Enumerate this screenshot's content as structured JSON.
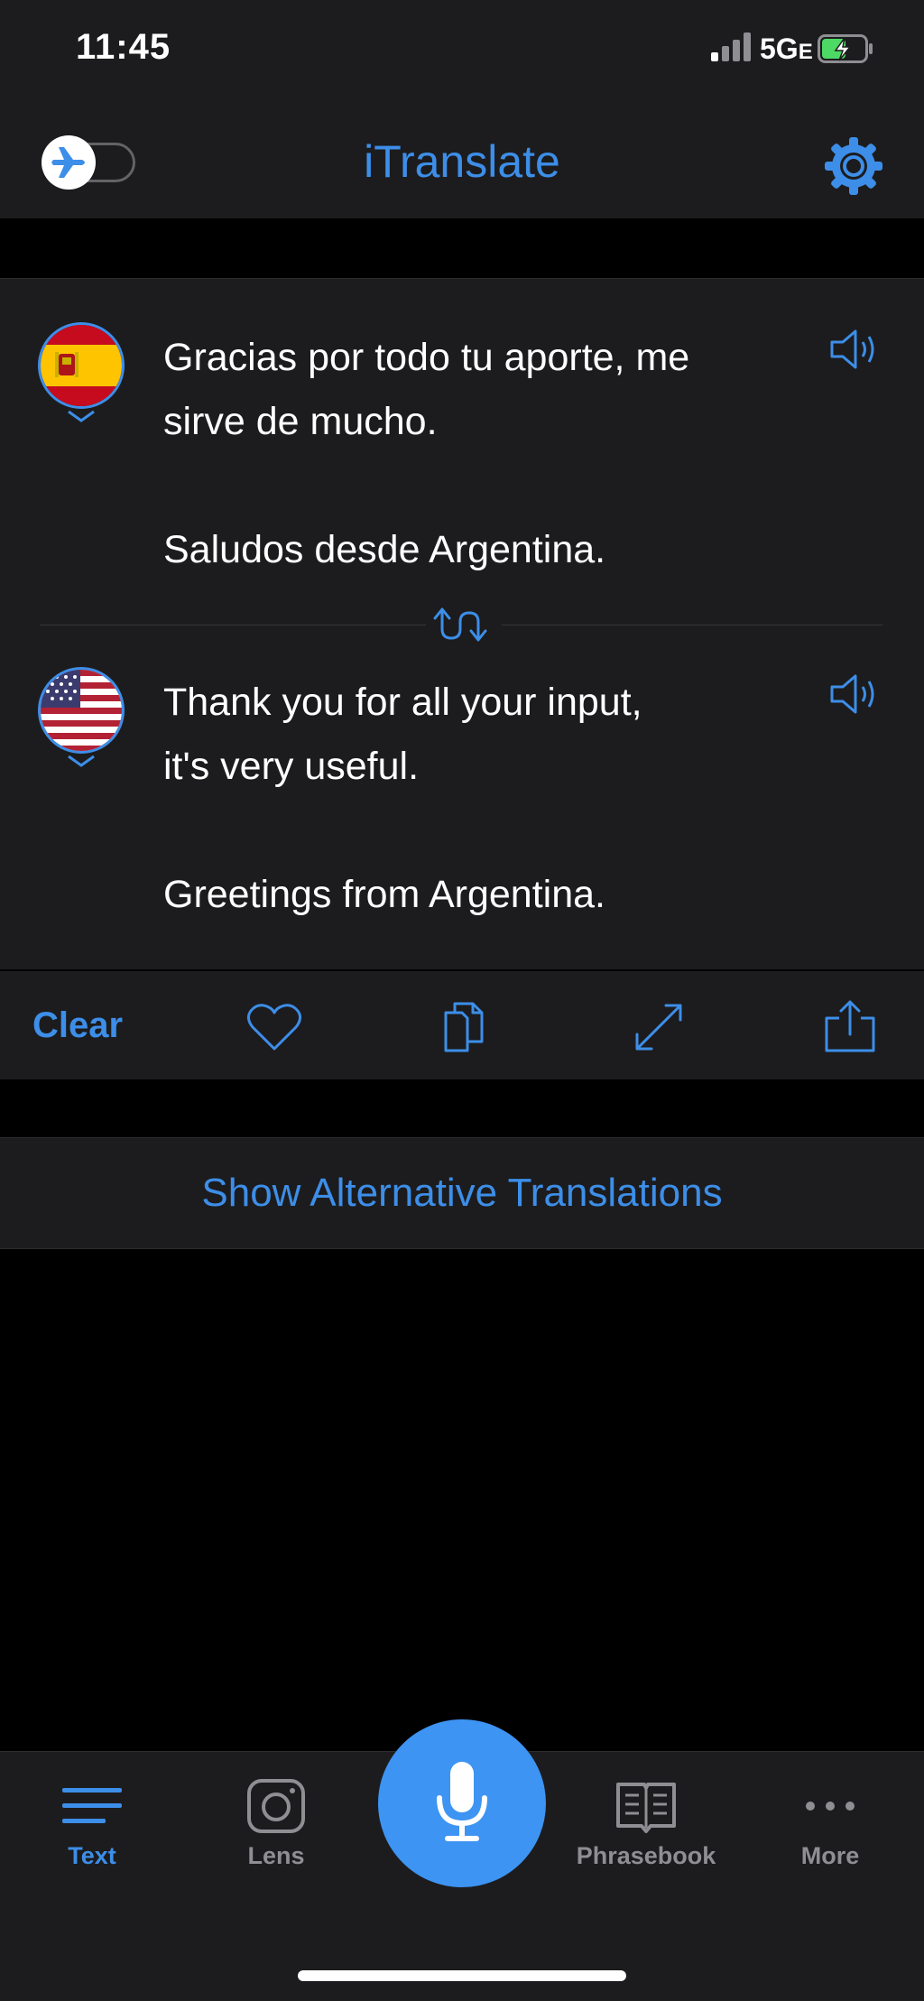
{
  "status_bar": {
    "time": "11:45",
    "network": "5G",
    "network_suffix": "E"
  },
  "header": {
    "title": "iTranslate",
    "offline_mode": false
  },
  "source": {
    "language_icon": "spain-flag-icon",
    "text": "Gracias por todo tu aporte, me\nsirve de mucho.\n\nSaludos desde Argentina."
  },
  "target": {
    "language_icon": "usa-flag-icon",
    "text": "Thank you for all your input,\nit's very useful.\n\nGreetings from Argentina."
  },
  "actions": {
    "clear_label": "Clear",
    "icons": [
      "heart-icon",
      "copy-icon",
      "expand-icon",
      "share-icon"
    ]
  },
  "alternatives": {
    "label": "Show Alternative Translations"
  },
  "tabs": [
    {
      "label": "Text",
      "icon": "text-lines-icon",
      "active": true
    },
    {
      "label": "Lens",
      "icon": "camera-icon",
      "active": false
    },
    {
      "label": "",
      "icon": "microphone-icon",
      "active": false
    },
    {
      "label": "Phrasebook",
      "icon": "book-icon",
      "active": false
    },
    {
      "label": "More",
      "icon": "ellipsis-icon",
      "active": false
    }
  ],
  "colors": {
    "accent": "#3d8ee8",
    "surface": "#1c1c1e",
    "background": "#000000",
    "mic": "#3d94f2"
  }
}
